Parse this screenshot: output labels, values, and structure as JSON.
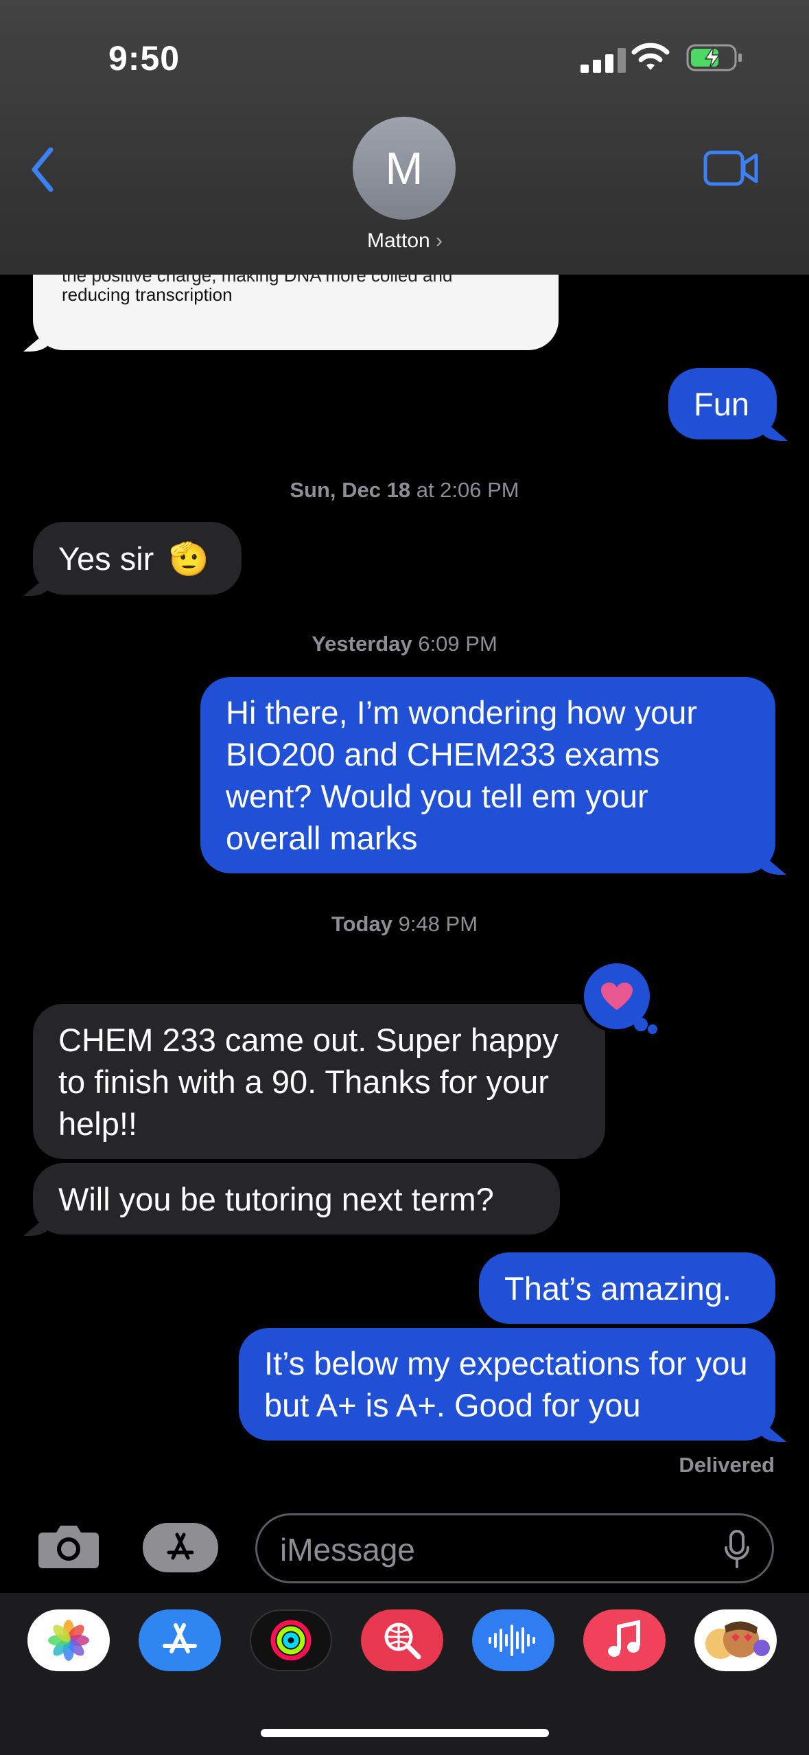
{
  "status_bar": {
    "time": "9:50"
  },
  "header": {
    "avatar_initial": "M",
    "contact_name": "Matton"
  },
  "partial_message": {
    "text": "reducing transcription",
    "clipped_line": "the positive charge, making DNA more coiled and"
  },
  "messages": [
    {
      "dir": "out",
      "text": "Fun"
    },
    {
      "dir": "stamp",
      "day": "Sun, Dec 18",
      "time": "at 2:06 PM"
    },
    {
      "dir": "in",
      "text": "Yes sir",
      "emoji": "🫡"
    },
    {
      "dir": "stamp",
      "day": "Yesterday",
      "time": "6:09 PM"
    },
    {
      "dir": "out",
      "text": "Hi there, I’m wondering how your BIO200 and CHEM233 exams went? Would you tell em your overall marks"
    },
    {
      "dir": "stamp",
      "day": "Today",
      "time": "9:48 PM"
    },
    {
      "dir": "in",
      "text": "CHEM 233 came out. Super happy to finish with a 90. Thanks for your help!!",
      "reaction": "heart"
    },
    {
      "dir": "in",
      "text": "Will you be tutoring next term?"
    },
    {
      "dir": "out",
      "text": "That’s amazing."
    },
    {
      "dir": "out",
      "text": "It’s below my expectations for you but A+ is A+. Good for you"
    }
  ],
  "delivery_status": "Delivered",
  "composer": {
    "placeholder": "iMessage"
  },
  "app_tray": [
    "photos-app",
    "app-store-app",
    "fitness-app",
    "search-images-app",
    "audio-message-app",
    "music-app",
    "memoji-app"
  ],
  "colors": {
    "outgoing": "#1f50d6",
    "incoming": "#262628",
    "accent": "#3b82f6",
    "reaction": "#e8578f"
  }
}
